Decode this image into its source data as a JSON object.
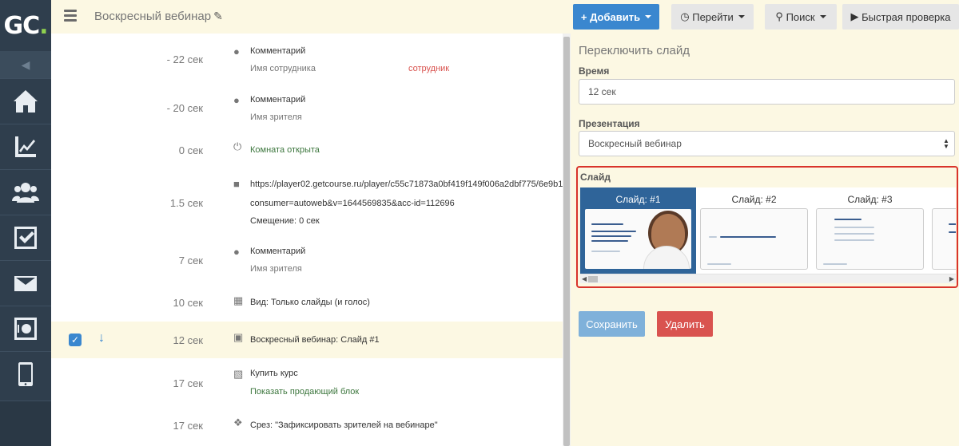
{
  "logo": {
    "text_main": "GC",
    "text_dot": "."
  },
  "topbar": {
    "title": "Воскресный вебинар",
    "add_label": "Добавить",
    "go_label": "Перейти",
    "search_label": "Поиск",
    "quick_label": "Быстрая проверка"
  },
  "sidebar": {
    "items": [
      {
        "icon": "home-icon"
      },
      {
        "icon": "chart-icon"
      },
      {
        "icon": "users-icon"
      },
      {
        "icon": "checkbox-icon"
      },
      {
        "icon": "mail-icon"
      },
      {
        "icon": "safe-icon"
      },
      {
        "icon": "phone-icon"
      }
    ]
  },
  "events": [
    {
      "time": "- 22 сек",
      "icon": "comment-icon",
      "title": "Комментарий",
      "sub": "Имя сотрудника",
      "extra": "сотрудник"
    },
    {
      "time": "- 20 сек",
      "icon": "comment-icon",
      "title": "Комментарий",
      "sub": "Имя зрителя"
    },
    {
      "time": "0 сек",
      "icon": "power-icon",
      "title": "",
      "sub": "Комната открыта"
    },
    {
      "time": "1.5 сек",
      "icon": "video-icon",
      "title": "https://player02.getcourse.ru/player/c55c71873a0bf419f149f006a2dbf775/6e9b1",
      "line2": "consumer=autoweb&v=1644569835&acc-id=112696",
      "line3": "Смещение: 0 сек"
    },
    {
      "time": "7 сек",
      "icon": "comment-icon",
      "title": "Комментарий",
      "sub": "Имя зрителя"
    },
    {
      "time": "10 сек",
      "icon": "grid-icon",
      "title": "Вид: Только слайды (и голос)"
    },
    {
      "time": "12 сек",
      "icon": "image-icon",
      "title": "Воскресный вебинар: Слайд #1",
      "check": "✓",
      "arrow": "↓"
    },
    {
      "time": "17 сек",
      "icon": "money-icon",
      "title": "Купить курс",
      "sub": "Показать продающий блок"
    },
    {
      "time": "17 сек",
      "icon": "pin-icon",
      "title": "Срез: \"Зафиксировать зрителей на вебинаре\""
    }
  ],
  "panel": {
    "title": "Переключить слайд",
    "time_label": "Время",
    "time_value": "12 сек",
    "presentation_label": "Презентация",
    "presentation_value": "Воскресный вебинар",
    "slide_label": "Слайд",
    "slides": [
      {
        "name": "Слайд: #1",
        "active": true
      },
      {
        "name": "Слайд: #2",
        "active": false
      },
      {
        "name": "Слайд: #3",
        "active": false
      }
    ],
    "save_label": "Сохранить",
    "delete_label": "Удалить"
  }
}
